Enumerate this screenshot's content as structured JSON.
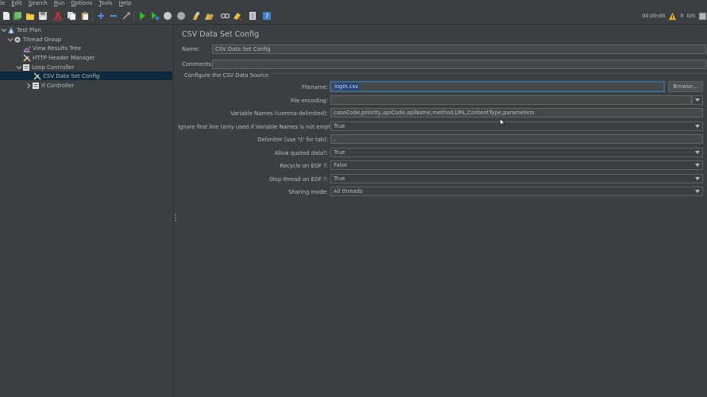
{
  "menu": [
    {
      "label": "File",
      "mnemonic": "F",
      "visible": "ile"
    },
    {
      "label": "Edit",
      "mnemonic": "E",
      "visible": "dit"
    },
    {
      "label": "Search",
      "mnemonic": "S",
      "visible": "earch"
    },
    {
      "label": "Run",
      "mnemonic": "R",
      "visible": "un"
    },
    {
      "label": "Options",
      "mnemonic": "O",
      "visible": "ptions"
    },
    {
      "label": "Tools",
      "mnemonic": "T",
      "visible": "ools"
    },
    {
      "label": "Help",
      "mnemonic": "H",
      "visible": "elp"
    }
  ],
  "status": {
    "elapsed": "00:00:00",
    "warnings": "0",
    "threads": "0/0"
  },
  "tree": [
    {
      "label": "Test Plan",
      "icon": "test-plan-icon",
      "expanded": true
    },
    {
      "label": "Thread Group",
      "icon": "gear-icon",
      "expanded": true
    },
    {
      "label": "View Results Tree",
      "icon": "chart-icon"
    },
    {
      "label": "HTTP Header Manager",
      "icon": "wrench-icon"
    },
    {
      "label": "Loop Controller",
      "icon": "controller-icon",
      "expanded": true
    },
    {
      "label": "CSV Data Set Config",
      "icon": "wrench-icon",
      "selected": true
    },
    {
      "label": "If Controller",
      "icon": "controller-icon",
      "expanded": false
    }
  ],
  "panel": {
    "title": "CSV Data Set Config",
    "name_label": "Name:",
    "name_value": "CSV Data Set Config",
    "comments_label": "Comments:",
    "comments_value": "",
    "section_title": "Configure the CSV Data Source",
    "filename_label": "Filename:",
    "filename_value": "login.csv",
    "browse_label": "Browse...",
    "encoding_label": "File encoding:",
    "encoding_value": "",
    "varnames_label": "Variable Names (comma-delimited):",
    "varnames_value": "caseCode,priority,apiCode,apiName,method,URL,ContentType,parameters",
    "ignore_label": "Ignore first line (only used if Variable Names is not empty):",
    "ignore_value": "True",
    "delimiter_label": "Delimiter (use '\\t' for tab):",
    "delimiter_value": ",",
    "quoted_label": "Allow quoted data?:",
    "quoted_value": "True",
    "recycle_label": "Recycle on EOF ?:",
    "recycle_value": "False",
    "stop_label": "Stop thread on EOF ?:",
    "stop_value": "True",
    "sharing_label": "Sharing mode:",
    "sharing_value": "All threads"
  },
  "colors": {
    "background": "#3c3f41",
    "selection": "#0d293e",
    "text": "#bbbbbb",
    "field_bg": "#45494a"
  }
}
